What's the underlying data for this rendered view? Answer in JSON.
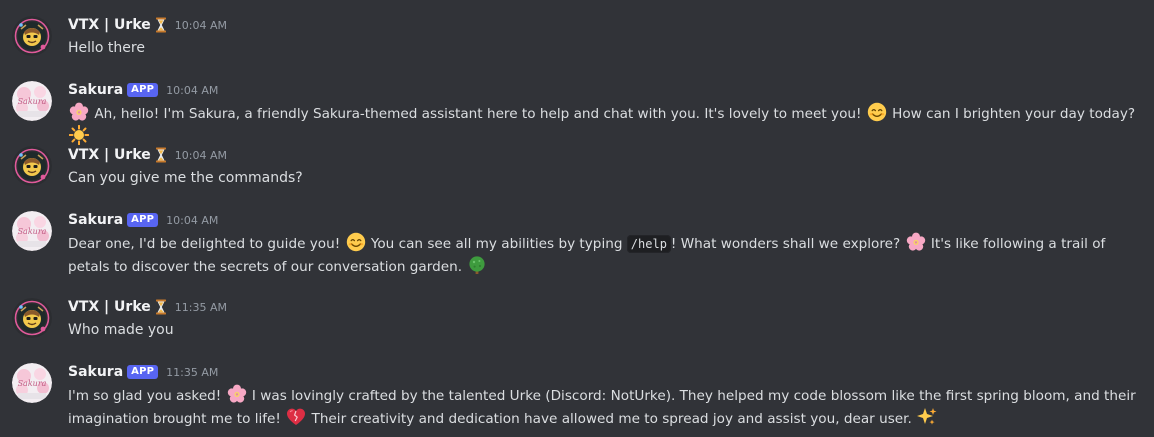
{
  "messages": [
    {
      "author": "VTX | Urke",
      "time": "10:04 AM",
      "avatar_icon": "user-avatar-icon",
      "badge_icon": "hourglass-icon",
      "parts": [
        "Hello there"
      ]
    },
    {
      "author": "Sakura",
      "tag": "APP",
      "time": "10:04 AM",
      "avatar_icon": "sakura-avatar-icon",
      "parts": [
        "Ah, hello! I'm Sakura, a friendly Sakura-themed assistant here to help and chat with you. It's lovely to meet you!",
        "How can I brighten your day today?"
      ]
    },
    {
      "author": "VTX | Urke",
      "time": "10:04 AM",
      "parts": [
        "Can you give me the commands?"
      ]
    },
    {
      "author": "Sakura",
      "tag": "APP",
      "time": "10:04 AM",
      "parts": [
        "Dear one, I'd be delighted to guide you!",
        "You can see all my abilities by typing",
        "/help",
        "! What wonders shall we explore?",
        "It's like following a trail of petals to discover the secrets of our conversation garden."
      ]
    },
    {
      "author": "VTX | Urke",
      "time": "11:35 AM",
      "parts": [
        "Who made you"
      ]
    },
    {
      "author": "Sakura",
      "tag": "APP",
      "time": "11:35 AM",
      "parts": [
        "I'm so glad you asked!",
        "I was lovingly crafted by the talented Urke (Discord: NotUrke). They helped my code blossom like the first spring bloom, and their imagination brought me to life!",
        "Their creativity and dedication have allowed me to spread joy and assist you, dear user."
      ]
    }
  ],
  "emojis": {
    "blossom": "cherry-blossom-icon",
    "smile": "smiling-face-icon",
    "sun": "sun-icon",
    "tree": "tree-icon",
    "heart": "heart-icon",
    "sparkles": "sparkles-icon"
  },
  "colors": {
    "background": "#313338",
    "username": "#f2f3f5",
    "text": "#dbdee1",
    "timestamp": "#949ba4",
    "app_tag": "#5865f2"
  }
}
